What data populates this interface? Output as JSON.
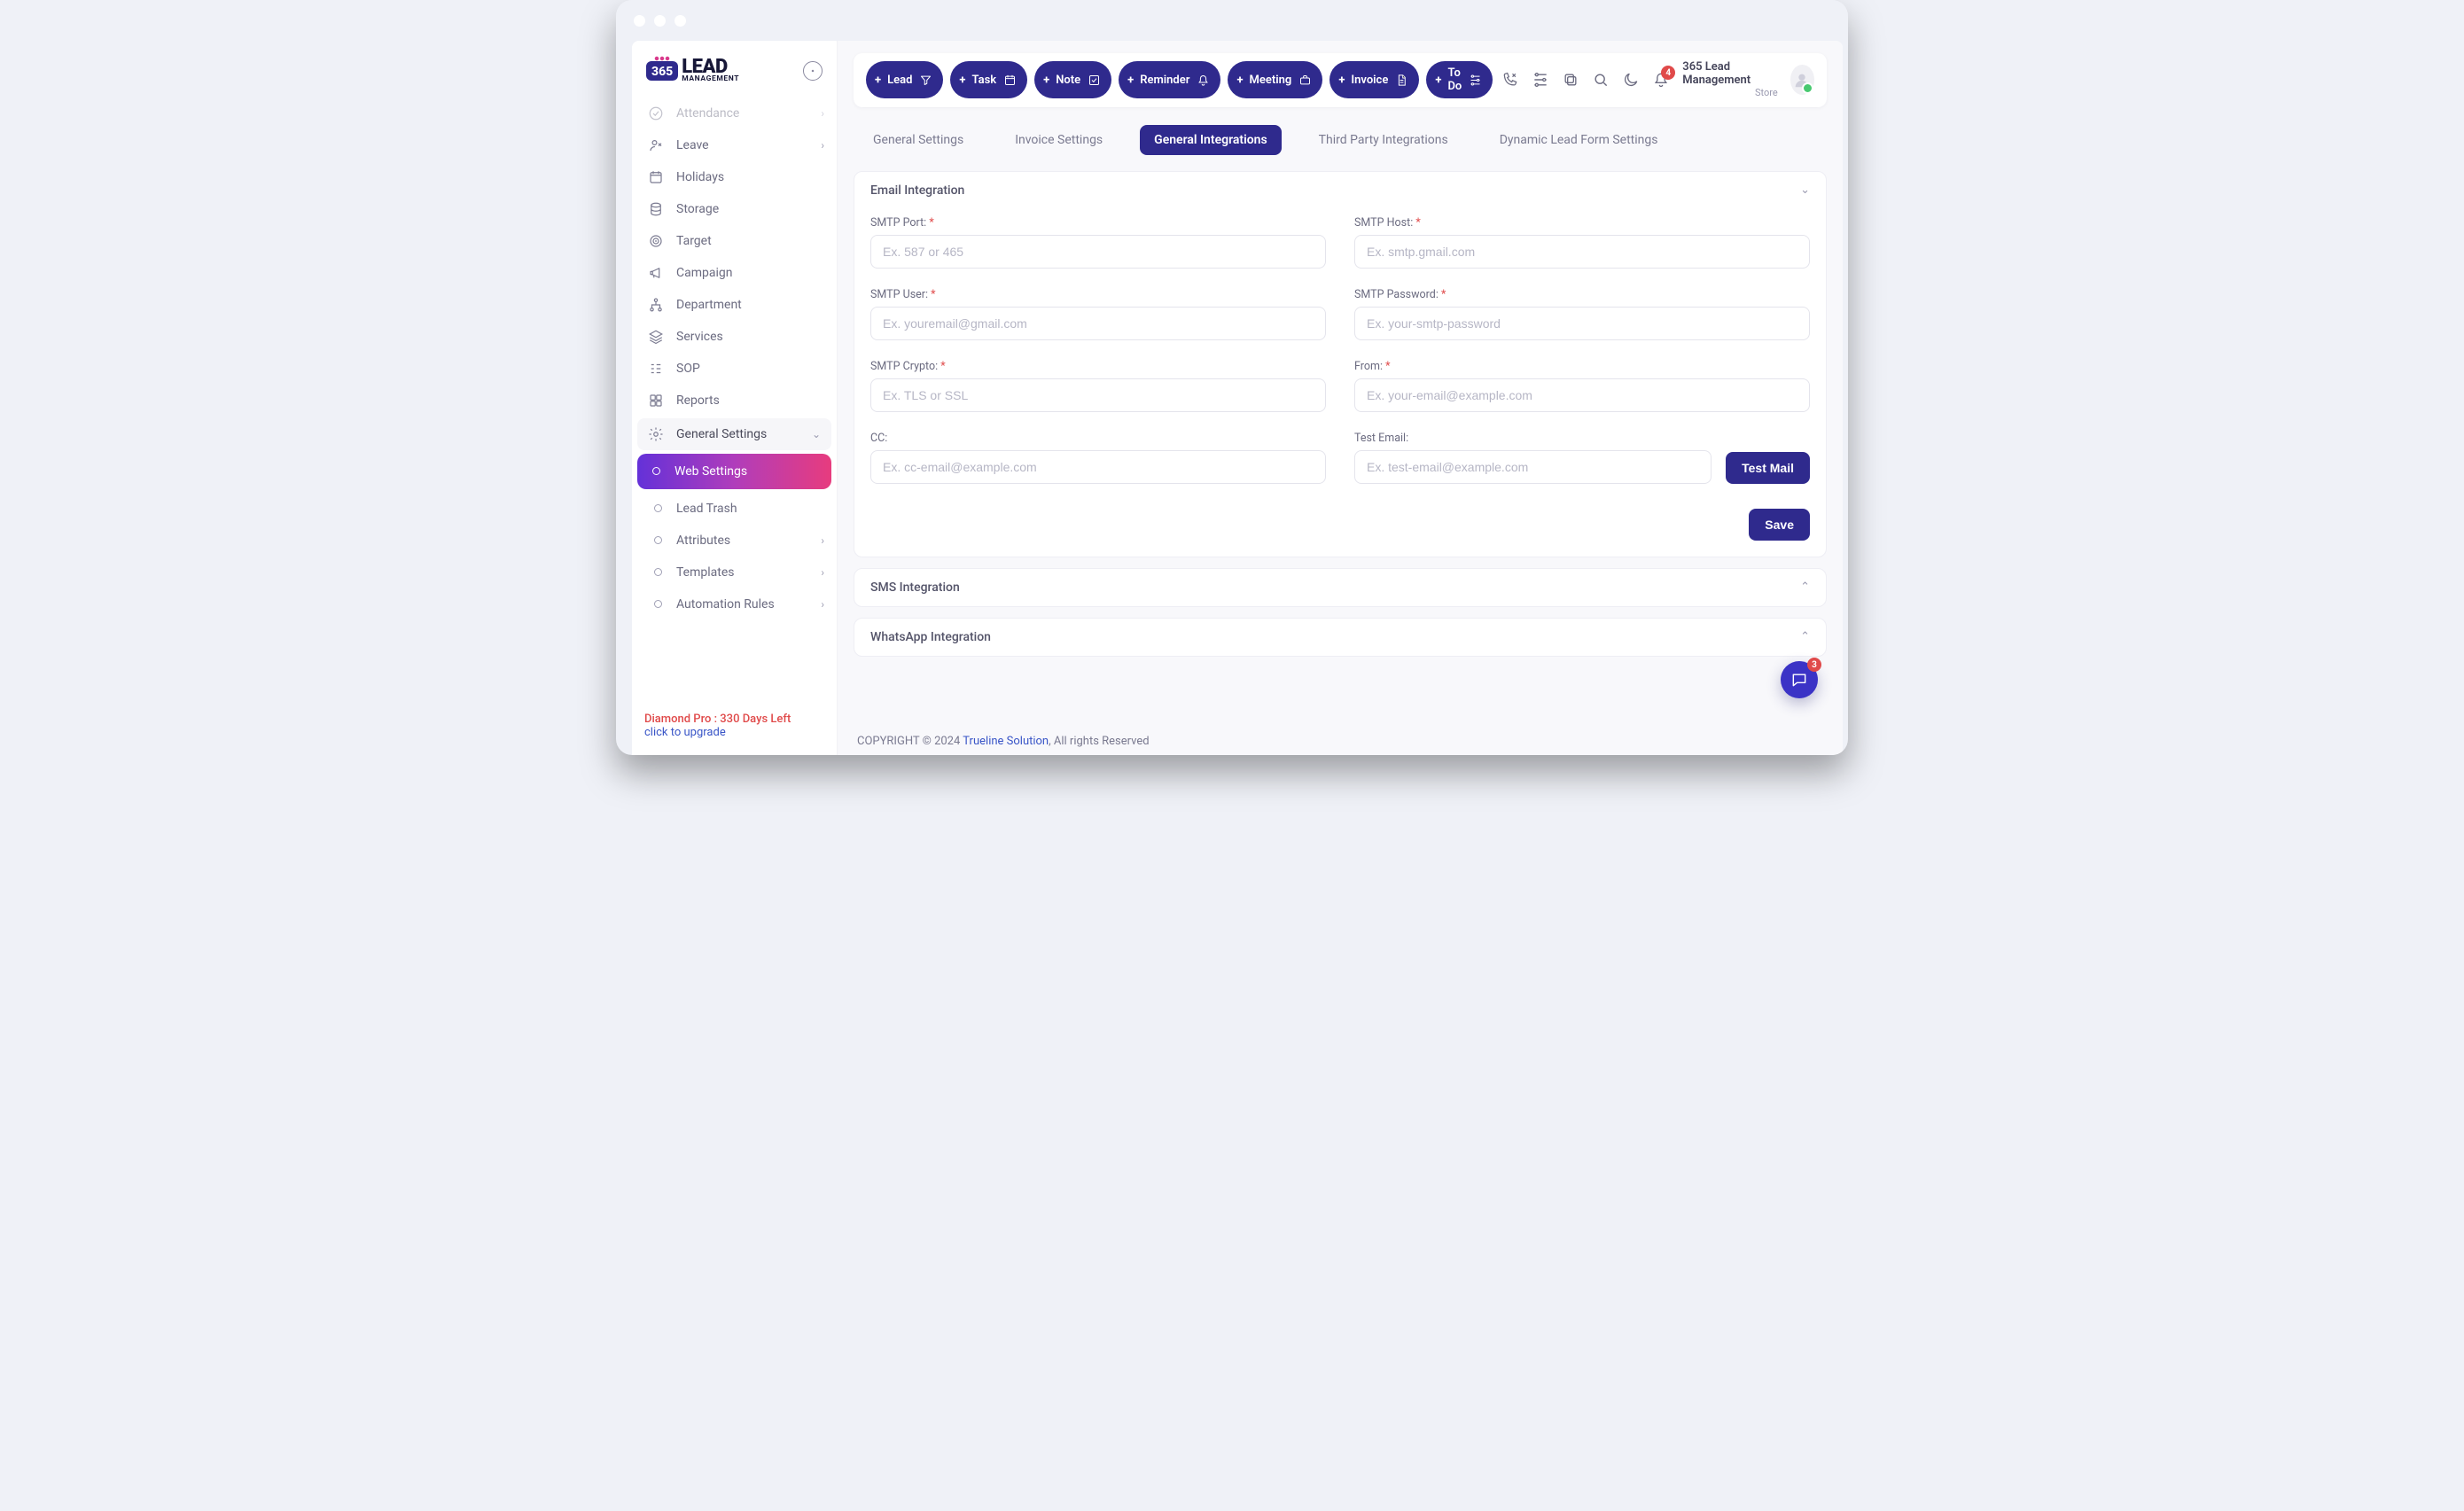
{
  "logo": {
    "badge": "365",
    "line1": "LEAD",
    "line2": "MANAGEMENT"
  },
  "sidebar": {
    "items": [
      {
        "label": "Attendance",
        "icon": "check-circle",
        "expandable": true,
        "faded": true
      },
      {
        "label": "Leave",
        "icon": "user-x",
        "expandable": true
      },
      {
        "label": "Holidays",
        "icon": "calendar"
      },
      {
        "label": "Storage",
        "icon": "database"
      },
      {
        "label": "Target",
        "icon": "target"
      },
      {
        "label": "Campaign",
        "icon": "megaphone"
      },
      {
        "label": "Department",
        "icon": "sitemap"
      },
      {
        "label": "Services",
        "icon": "layers"
      },
      {
        "label": "SOP",
        "icon": "list-tree"
      },
      {
        "label": "Reports",
        "icon": "grid"
      },
      {
        "label": "General Settings",
        "icon": "gear",
        "expandable": true,
        "open": true,
        "activeParent": true
      }
    ],
    "subitems": [
      {
        "label": "Web Settings",
        "active": true
      },
      {
        "label": "Lead Trash"
      },
      {
        "label": "Attributes",
        "expandable": true
      },
      {
        "label": "Templates",
        "expandable": true
      },
      {
        "label": "Automation Rules",
        "expandable": true
      }
    ]
  },
  "upgrade": {
    "line1": "Diamond Pro : 330 Days Left",
    "line2": "click to upgrade"
  },
  "header": {
    "buttons": [
      {
        "label": "Lead",
        "trail": "filter"
      },
      {
        "label": "Task",
        "trail": "calendar"
      },
      {
        "label": "Note",
        "trail": "check-square"
      },
      {
        "label": "Reminder",
        "trail": "bell"
      },
      {
        "label": "Meeting",
        "trail": "briefcase"
      },
      {
        "label": "Invoice",
        "trail": "file"
      },
      {
        "label": "To Do",
        "trail": "sliders"
      }
    ],
    "notif_count": "4",
    "org_name": "365 Lead Management",
    "org_sub": "Store"
  },
  "tabs": [
    {
      "label": "General Settings"
    },
    {
      "label": "Invoice Settings"
    },
    {
      "label": "General Integrations",
      "active": true
    },
    {
      "label": "Third Party Integrations"
    },
    {
      "label": "Dynamic Lead Form Settings"
    }
  ],
  "email_panel": {
    "title": "Email Integration",
    "fields": {
      "smtp_port": {
        "label": "SMTP Port:",
        "required": true,
        "placeholder": "Ex. 587 or 465"
      },
      "smtp_host": {
        "label": "SMTP Host:",
        "required": true,
        "placeholder": "Ex. smtp.gmail.com"
      },
      "smtp_user": {
        "label": "SMTP User:",
        "required": true,
        "placeholder": "Ex. youremail@gmail.com"
      },
      "smtp_pass": {
        "label": "SMTP Password:",
        "required": true,
        "placeholder": "Ex. your-smtp-password"
      },
      "smtp_crypto": {
        "label": "SMTP Crypto:",
        "required": true,
        "placeholder": "Ex. TLS or SSL"
      },
      "from": {
        "label": "From:",
        "required": true,
        "placeholder": "Ex. your-email@example.com"
      },
      "cc": {
        "label": "CC:",
        "required": false,
        "placeholder": "Ex. cc-email@example.com"
      },
      "test_email": {
        "label": "Test Email:",
        "required": false,
        "placeholder": "Ex. test-email@example.com"
      }
    },
    "test_btn": "Test Mail",
    "save_btn": "Save"
  },
  "sms_panel": {
    "title": "SMS Integration"
  },
  "whatsapp_panel": {
    "title": "WhatsApp Integration"
  },
  "footer": {
    "prefix": "COPYRIGHT © 2024 ",
    "link": "Trueline Solution",
    "suffix": ", All rights Reserved"
  },
  "chat_badge": "3"
}
